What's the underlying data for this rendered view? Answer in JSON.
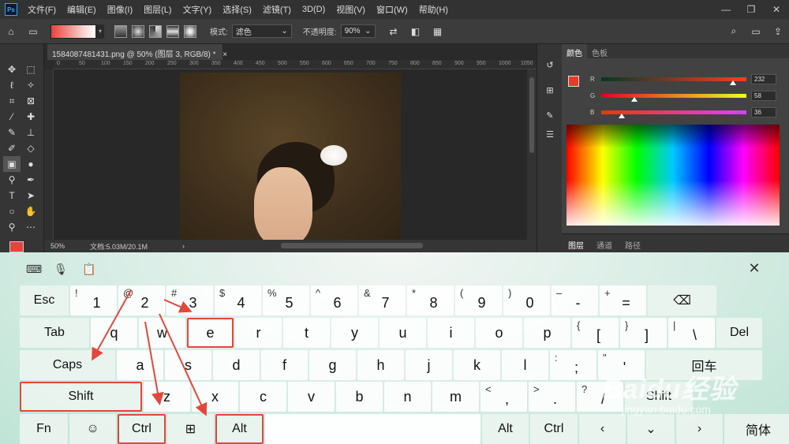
{
  "app": {
    "logo": "Ps"
  },
  "menubar": {
    "items": [
      "文件(F)",
      "编辑(E)",
      "图像(I)",
      "图层(L)",
      "文字(Y)",
      "选择(S)",
      "滤镜(T)",
      "3D(D)",
      "视图(V)",
      "窗口(W)",
      "帮助(H)"
    ]
  },
  "options_bar": {
    "mode_label": "模式:",
    "mode_value": "滤色",
    "opacity_label": "不透明度:",
    "opacity_value": "90%",
    "gradient_colors": [
      "#e8423a",
      "#ffffff"
    ]
  },
  "document": {
    "tab_title": "1584087481431.png @ 50% (图层 3, RGB/8) *",
    "tab_close": "×",
    "ruler_marks": [
      "0",
      "50",
      "100",
      "150",
      "200",
      "250",
      "300",
      "350",
      "400",
      "450",
      "500",
      "550",
      "600",
      "650",
      "700",
      "750",
      "800",
      "850",
      "900",
      "950",
      "1000",
      "1050"
    ],
    "zoom": "50%",
    "doc_size": "文档:5.03M/20.1M"
  },
  "color_panel": {
    "tabs": [
      "颜色",
      "色板"
    ],
    "active_tab": "颜色",
    "foreground": "#e83a24",
    "channels": [
      {
        "label": "R",
        "value": "232",
        "fraction": 0.91
      },
      {
        "label": "G",
        "value": "58",
        "fraction": 0.23
      },
      {
        "label": "B",
        "value": "36",
        "fraction": 0.14
      }
    ]
  },
  "layers_panel": {
    "tabs": [
      "图层",
      "通道",
      "路径"
    ]
  },
  "keyboard": {
    "rows": [
      [
        {
          "id": "esc",
          "label": "Esc",
          "fn": true
        },
        {
          "id": "1",
          "label": "1",
          "sec": "!"
        },
        {
          "id": "2",
          "label": "2",
          "sec": "@"
        },
        {
          "id": "3",
          "label": "3",
          "sec": "#"
        },
        {
          "id": "4",
          "label": "4",
          "sec": "$"
        },
        {
          "id": "5",
          "label": "5",
          "sec": "%"
        },
        {
          "id": "6",
          "label": "6",
          "sec": "^"
        },
        {
          "id": "7",
          "label": "7",
          "sec": "&"
        },
        {
          "id": "8",
          "label": "8",
          "sec": "*"
        },
        {
          "id": "9",
          "label": "9",
          "sec": "("
        },
        {
          "id": "0",
          "label": "0",
          "sec": ")"
        },
        {
          "id": "minus",
          "label": "-",
          "sec": "–"
        },
        {
          "id": "equals",
          "label": "=",
          "sec": "+"
        },
        {
          "id": "backspace",
          "label": "⌫",
          "fn": true
        }
      ],
      [
        {
          "id": "tab",
          "label": "Tab",
          "fn": true
        },
        {
          "id": "q",
          "label": "q"
        },
        {
          "id": "w",
          "label": "w"
        },
        {
          "id": "e",
          "label": "e",
          "hl": true
        },
        {
          "id": "r",
          "label": "r"
        },
        {
          "id": "t",
          "label": "t"
        },
        {
          "id": "y",
          "label": "y"
        },
        {
          "id": "u",
          "label": "u"
        },
        {
          "id": "i",
          "label": "i"
        },
        {
          "id": "o",
          "label": "o"
        },
        {
          "id": "p",
          "label": "p"
        },
        {
          "id": "lbracket",
          "label": "[",
          "sec": "{"
        },
        {
          "id": "rbracket",
          "label": "]",
          "sec": "}"
        },
        {
          "id": "backslash",
          "label": "\\",
          "sec": "|"
        },
        {
          "id": "del",
          "label": "Del",
          "fn": true
        }
      ],
      [
        {
          "id": "caps",
          "label": "Caps",
          "fn": true
        },
        {
          "id": "a",
          "label": "a"
        },
        {
          "id": "s",
          "label": "s"
        },
        {
          "id": "d",
          "label": "d"
        },
        {
          "id": "f",
          "label": "f"
        },
        {
          "id": "g",
          "label": "g"
        },
        {
          "id": "h",
          "label": "h"
        },
        {
          "id": "j",
          "label": "j"
        },
        {
          "id": "k",
          "label": "k"
        },
        {
          "id": "l",
          "label": "l"
        },
        {
          "id": "semicolon",
          "label": ";",
          "sec": ":"
        },
        {
          "id": "quote",
          "label": "'",
          "sec": "\""
        },
        {
          "id": "enter",
          "label": "回车",
          "fn": true
        }
      ],
      [
        {
          "id": "lshift",
          "label": "Shift",
          "fn": true,
          "hl": true
        },
        {
          "id": "z",
          "label": "z"
        },
        {
          "id": "x",
          "label": "x"
        },
        {
          "id": "c",
          "label": "c"
        },
        {
          "id": "v",
          "label": "v"
        },
        {
          "id": "b",
          "label": "b"
        },
        {
          "id": "n",
          "label": "n"
        },
        {
          "id": "m",
          "label": "m"
        },
        {
          "id": "comma",
          "label": ",",
          "sec": "<"
        },
        {
          "id": "period",
          "label": ".",
          "sec": ">"
        },
        {
          "id": "slash",
          "label": "/",
          "sec": "?"
        },
        {
          "id": "rshift",
          "label": "Shift",
          "fn": true
        }
      ],
      [
        {
          "id": "fn",
          "label": "Fn",
          "fn": true
        },
        {
          "id": "emoji",
          "label": "☺",
          "fn": true
        },
        {
          "id": "lctrl",
          "label": "Ctrl",
          "fn": true,
          "hl": true
        },
        {
          "id": "win",
          "label": "win",
          "fn": true
        },
        {
          "id": "lalt",
          "label": "Alt",
          "fn": true,
          "hl": true
        },
        {
          "id": "space",
          "label": ""
        },
        {
          "id": "ralt",
          "label": "Alt",
          "fn": true
        },
        {
          "id": "rctrl",
          "label": "Ctrl",
          "fn": true
        },
        {
          "id": "left",
          "label": "‹",
          "fn": true
        },
        {
          "id": "down",
          "label": "⌄",
          "fn": true
        },
        {
          "id": "right",
          "label": "›",
          "fn": true
        },
        {
          "id": "ime",
          "label": "简体",
          "fn": true
        }
      ]
    ],
    "annotation_color": "#e2473c"
  },
  "watermark": {
    "brand": "Baidu经验",
    "url": "jingyan.baidu.com"
  }
}
